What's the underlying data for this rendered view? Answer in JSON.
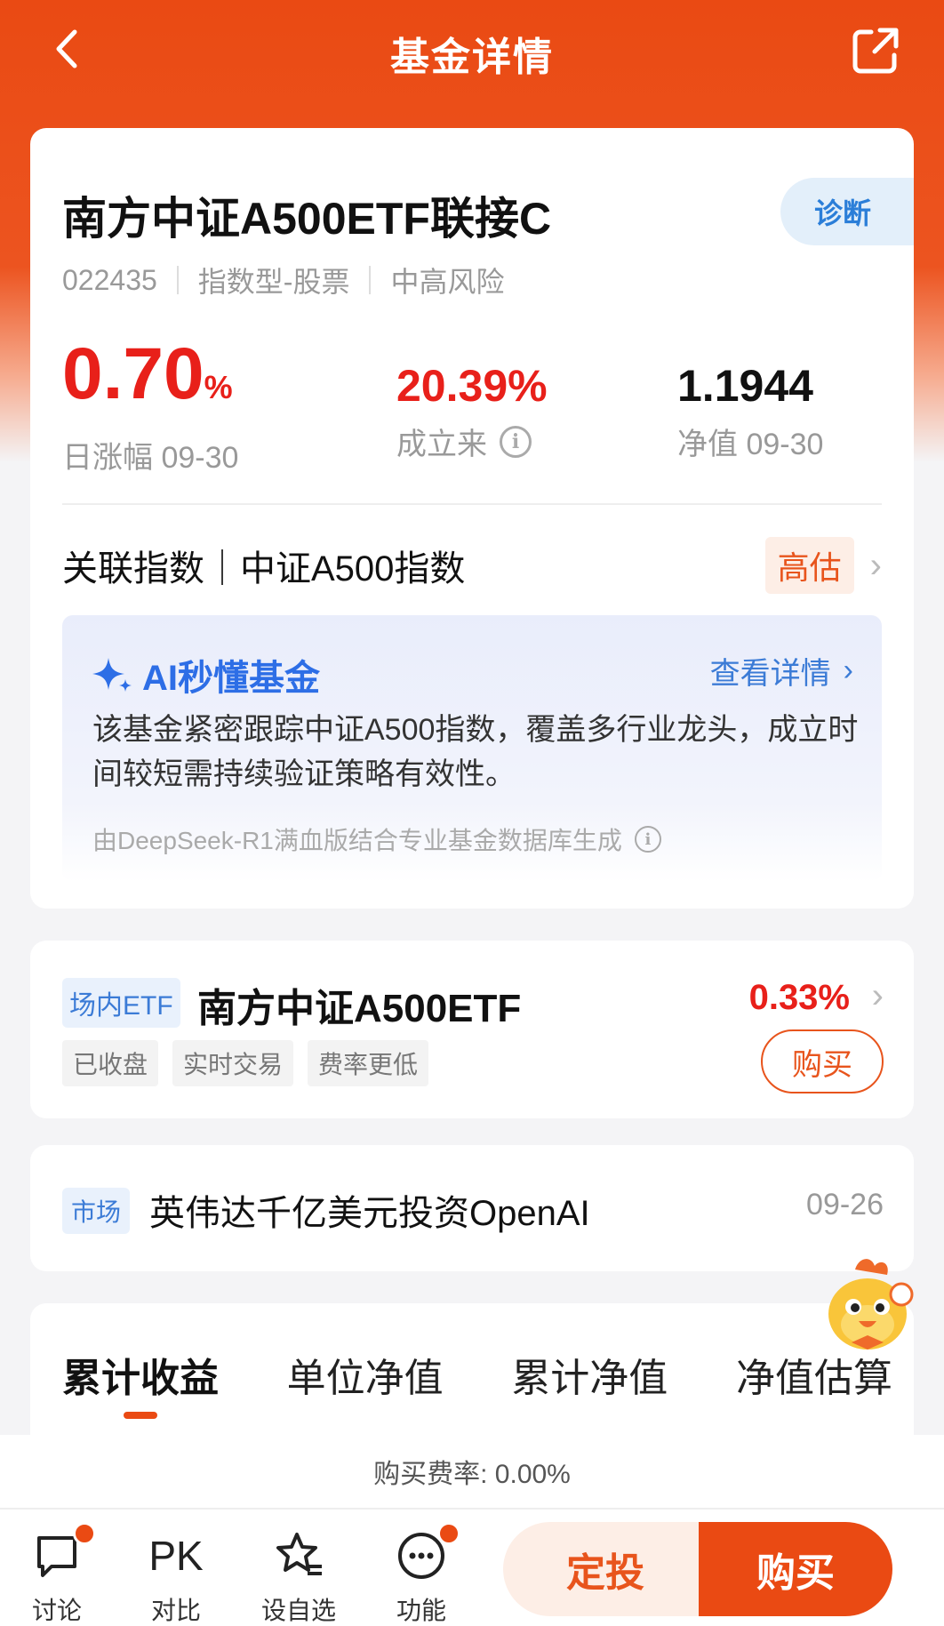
{
  "nav": {
    "title": "基金详情"
  },
  "fund": {
    "name": "南方中证A500ETF联接C",
    "diagnose_label": "诊断",
    "code": "022435",
    "type": "指数型-股票",
    "risk": "中高风险"
  },
  "metrics": {
    "daily_change": "0.70",
    "daily_change_unit": "%",
    "daily_change_label": "日涨幅 09-30",
    "since_inception": "20.39%",
    "since_inception_label": "成立来",
    "nav_value": "1.1944",
    "nav_label": "净值 09-30"
  },
  "index": {
    "text": "关联指数｜中证A500指数",
    "badge": "高估"
  },
  "ai": {
    "title": "AI秒懂基金",
    "more": "查看详情",
    "text": "该基金紧密跟踪中证A500指数，覆盖多行业龙头，成立时间较短需持续验证策略有效性。",
    "footer": "由DeepSeek-R1满血版结合专业基金数据库生成"
  },
  "etf": {
    "tag": "场内ETF",
    "name": "南方中证A500ETF",
    "change": "0.33%",
    "chips": [
      "已收盘",
      "实时交易",
      "费率更低"
    ],
    "buy_label": "购买"
  },
  "news": {
    "tag": "市场",
    "headline": "英伟达千亿美元投资OpenAI",
    "date": "09-26"
  },
  "tabs": [
    {
      "label": "累计收益",
      "active": true
    },
    {
      "label": "单位净值",
      "active": false
    },
    {
      "label": "累计净值",
      "active": false
    },
    {
      "label": "净值估算",
      "active": false
    }
  ],
  "fee": {
    "text": "购买费率: 0.00%"
  },
  "bottom": {
    "discuss": "讨论",
    "compare_icon": "PK",
    "compare": "对比",
    "watchlist": "设自选",
    "functions": "功能",
    "sip": "定投",
    "buy": "购买"
  },
  "colors": {
    "brand": "#ea4a13",
    "rise": "#e8201a",
    "link": "#3b7bd6"
  }
}
